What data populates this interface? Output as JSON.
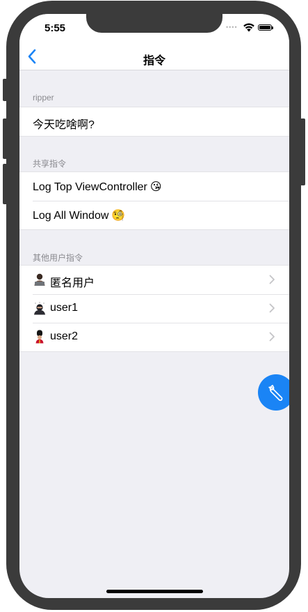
{
  "status_bar": {
    "time": "5:55",
    "signal": "••••"
  },
  "nav": {
    "title": "指令",
    "back_icon": "chevron-left-icon"
  },
  "colors": {
    "accent": "#1a84f5",
    "background": "#efeff4",
    "section_header": "#8a8a8f"
  },
  "sections": [
    {
      "header": "ripper",
      "rows": [
        {
          "label": "今天吃啥啊?",
          "emoji": "",
          "chevron": false
        }
      ]
    },
    {
      "header": "共享指令",
      "rows": [
        {
          "label": "Log Top ViewController",
          "emoji": "😘",
          "chevron": false
        },
        {
          "label": "Log All Window",
          "emoji": "🧐",
          "chevron": false
        }
      ]
    },
    {
      "header": "其他用户指令",
      "rows": [
        {
          "label": "匿名用户",
          "icon": "person-laptop-icon",
          "chevron": true
        },
        {
          "label": "user1",
          "icon": "ninja-icon",
          "chevron": true
        },
        {
          "label": "user2",
          "icon": "guard-icon",
          "chevron": true
        }
      ]
    }
  ],
  "fab": {
    "icon": "wrench-icon"
  }
}
